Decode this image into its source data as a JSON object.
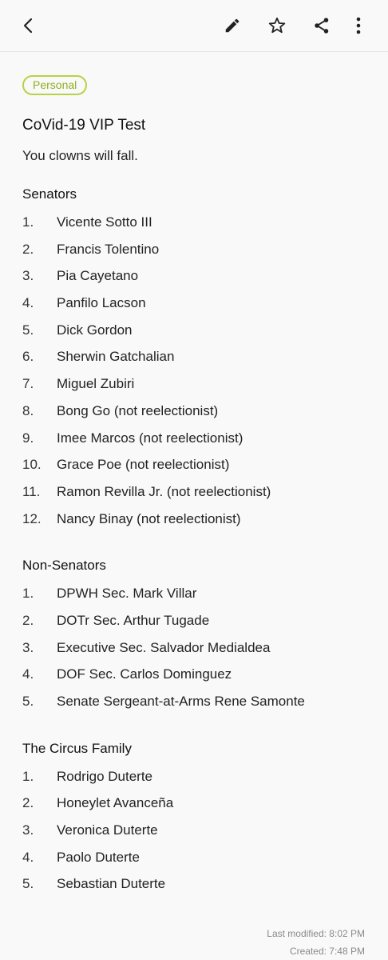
{
  "toolbar": {
    "back_icon": "chevron-left-icon",
    "edit_icon": "pencil-icon",
    "favorite_icon": "star-outline-icon",
    "share_icon": "share-icon",
    "more_icon": "more-vertical-icon"
  },
  "note": {
    "category": "Personal",
    "title": "CoVid-19 VIP Test",
    "intro": "You clowns will fall.",
    "sections": [
      {
        "heading": "Senators",
        "items": [
          {
            "num": "1.",
            "text": "Vicente Sotto III"
          },
          {
            "num": "2.",
            "text": "Francis Tolentino"
          },
          {
            "num": "3.",
            "text": "Pia Cayetano"
          },
          {
            "num": "4.",
            "text": "Panfilo Lacson"
          },
          {
            "num": "5.",
            "text": "Dick Gordon"
          },
          {
            "num": "6.",
            "text": "Sherwin Gatchalian"
          },
          {
            "num": "7.",
            "text": "Miguel Zubiri"
          },
          {
            "num": "8.",
            "text": "Bong Go (not reelectionist)"
          },
          {
            "num": "9.",
            "text": "Imee Marcos (not reelectionist)"
          },
          {
            "num": "10.",
            "text": "Grace Poe (not reelectionist)"
          },
          {
            "num": "11.",
            "text": "Ramon Revilla Jr. (not reelectionist)"
          },
          {
            "num": "12.",
            "text": "Nancy Binay (not reelectionist)"
          }
        ]
      },
      {
        "heading": "Non-Senators",
        "items": [
          {
            "num": "1.",
            "text": "DPWH Sec. Mark Villar"
          },
          {
            "num": "2.",
            "text": "DOTr Sec. Arthur Tugade"
          },
          {
            "num": "3.",
            "text": "Executive Sec. Salvador Medialdea"
          },
          {
            "num": "4.",
            "text": "DOF Sec. Carlos Dominguez"
          },
          {
            "num": "5.",
            "text": "Senate Sergeant-at-Arms Rene Samonte"
          }
        ]
      },
      {
        "heading": "The Circus Family",
        "items": [
          {
            "num": "1.",
            "text": "Rodrigo Duterte"
          },
          {
            "num": "2.",
            "text": "Honeylet Avanceña"
          },
          {
            "num": "3.",
            "text": "Veronica Duterte"
          },
          {
            "num": "4.",
            "text": "Paolo Duterte"
          },
          {
            "num": "5.",
            "text": "Sebastian Duterte"
          }
        ]
      }
    ],
    "last_modified": "Last modified: 8:02 PM",
    "created": "Created: 7:48 PM"
  },
  "colors": {
    "background": "#f9f9f9",
    "tag_border": "#b8d246",
    "tag_text": "#8fae1f",
    "meta_text": "#8a8a8a"
  }
}
